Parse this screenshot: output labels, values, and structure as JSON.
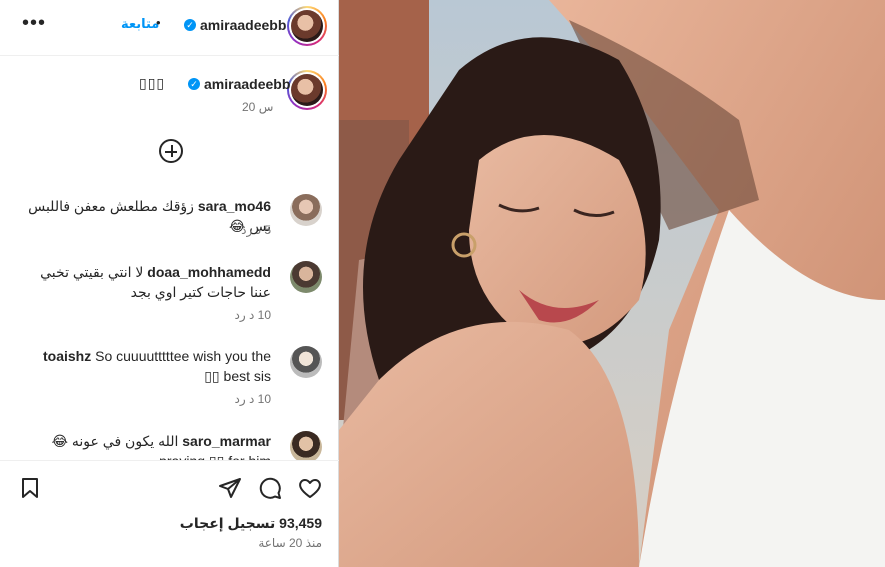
{
  "header": {
    "username": "amiraadeebb",
    "verified_icon": "verified-badge-icon",
    "follow_label": "متابعة",
    "separator": "•",
    "more_label": "•••"
  },
  "caption": {
    "username": "amiraadeebb",
    "text": "▯▯▯",
    "time": "20 س"
  },
  "comments": [
    {
      "username": "sara_mo46",
      "text": "زؤقك مطلعش معفن فاللبس بس 😂",
      "meta": "5 د  رد"
    },
    {
      "username": "doaa_mohhamedd",
      "text": "لا انتي بقيتي تخبي عننا حاجات كتير اوي بجد",
      "meta": "10 د  رد"
    },
    {
      "username": "toaishz",
      "text": "So cuuuutttttee wish you the best sis ▯▯",
      "meta": "10 د  رد"
    },
    {
      "username": "saro_marmar",
      "text": "الله يكون في عونه 😂 praying ▯▯ for him",
      "meta": ""
    }
  ],
  "actions": {
    "like_icon": "heart-icon",
    "comment_icon": "comment-icon",
    "share_icon": "share-icon",
    "save_icon": "bookmark-icon"
  },
  "likes_text": "93,459 تسجيل إعجاب",
  "time_ago": "منذ 20 ساعة",
  "colors": {
    "accent": "#0095f6",
    "text": "#262626",
    "muted": "#737373"
  }
}
